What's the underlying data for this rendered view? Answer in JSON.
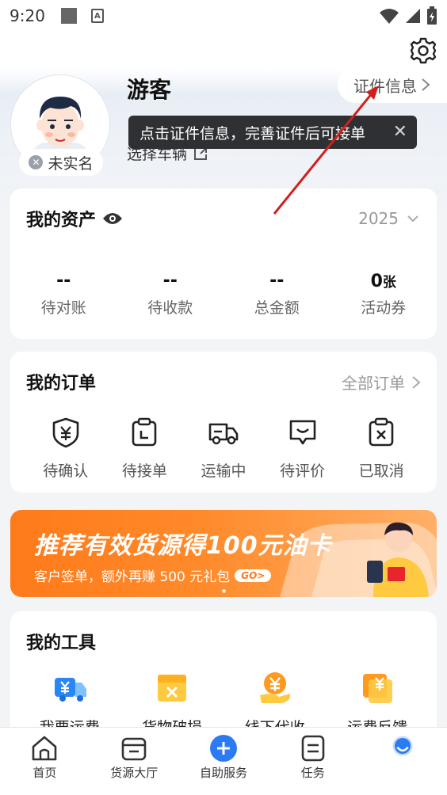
{
  "status_bar": {
    "time": "9:20"
  },
  "profile": {
    "username": "游客",
    "real_name_status": "未实名",
    "cert_info_label": "证件信息",
    "select_vehicle_label": "选择车辆"
  },
  "tooltip": {
    "text": "点击证件信息，完善证件后可接单"
  },
  "assets": {
    "title": "我的资产",
    "year": "2025",
    "items": [
      {
        "value": "--",
        "unit": "",
        "label": "待对账"
      },
      {
        "value": "--",
        "unit": "",
        "label": "待收款"
      },
      {
        "value": "--",
        "unit": "",
        "label": "总金额"
      },
      {
        "value": "0",
        "unit": "张",
        "label": "活动券"
      }
    ]
  },
  "orders": {
    "title": "我的订单",
    "all_label": "全部订单",
    "items": [
      {
        "label": "待确认",
        "icon": "yen-shield-icon"
      },
      {
        "label": "待接单",
        "icon": "clipboard-clock-icon"
      },
      {
        "label": "运输中",
        "icon": "truck-icon"
      },
      {
        "label": "待评价",
        "icon": "comment-smile-icon"
      },
      {
        "label": "已取消",
        "icon": "clipboard-x-icon"
      }
    ]
  },
  "banner": {
    "title": "推荐有效货源得100元油卡",
    "subtitle": "客户签单，额外再赚 500 元礼包",
    "go_label": "GO>"
  },
  "tools": {
    "title": "我的工具",
    "items": [
      {
        "label": "我要运费",
        "icon": "yen-truck-icon"
      },
      {
        "label": "货物破损",
        "icon": "damaged-box-icon"
      },
      {
        "label": "线下代收",
        "icon": "yen-hand-icon"
      },
      {
        "label": "运费反馈",
        "icon": "yen-feedback-icon"
      }
    ]
  },
  "bottom_nav": {
    "items": [
      {
        "label": "首页",
        "icon": "home-icon"
      },
      {
        "label": "货源大厅",
        "icon": "cargo-hall-icon"
      },
      {
        "label": "自助服务",
        "icon": "plus-circle-icon"
      },
      {
        "label": "任务",
        "icon": "task-icon"
      },
      {
        "label": "",
        "icon": "profile-ring-icon"
      }
    ]
  },
  "colors": {
    "accent": "#2a7bf4",
    "banner_orange": "#ff7a1a",
    "annotation_red": "#d0201e"
  }
}
